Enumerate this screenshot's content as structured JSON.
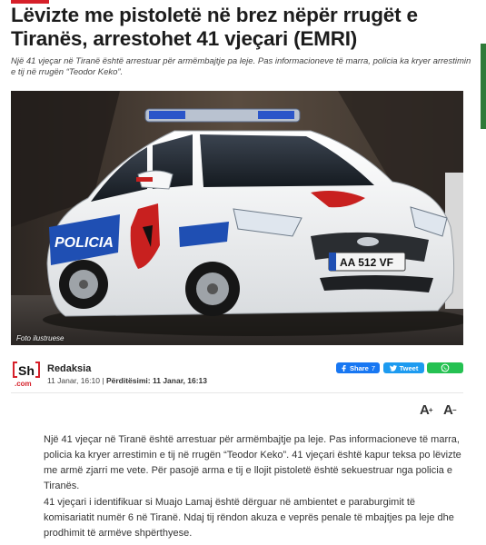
{
  "article": {
    "title": "Lëvizte me pistoletë në brez nëpër rrugët e Tiranës, arrestohet 41 vjeçari (EMRI)",
    "lead": "Një 41 vjeçar në Tiranë është arrestuar për armëmbajtje pa leje. Pas informacioneve të marra, policia ka kryer arrestimin e tij në rrugën “Teodor Keko”.",
    "photo_caption": "Foto ilustruese",
    "photo_texts": {
      "car_side_label": "POLICIA",
      "license_plate": "AA 512 VF"
    },
    "author": {
      "logo_text_top": "Sh",
      "logo_text_bottom": ".com",
      "name": "Redaksia"
    },
    "published": "11 Janar, 16:10",
    "updated_label": "Përditësimi:",
    "updated": "11 Janar, 16:13",
    "share": {
      "facebook_label": "Share",
      "facebook_count": "7",
      "twitter_label": "Tweet",
      "whatsapp_icon": "whatsapp-icon"
    },
    "font_controls": {
      "increase": "A",
      "decrease": "A",
      "increase_mark": "+",
      "decrease_mark": "−"
    },
    "paragraphs": [
      "Një 41 vjeçar në Tiranë është arrestuar për armëmbajtje pa leje. Pas informacioneve të marra, policia ka kryer arrestimin e tij në rrugën “Teodor Keko”. 41 vjeçari është kapur teksa po lëvizte me armë zjarri me vete. Për pasojë arma e tij e llojit pistoletë është sekuestruar nga policia e Tiranës.",
      "41 vjeçari i identifikuar si Muajo Lamaj është dërguar në ambientet e paraburgimit të komisariatit numër 6 në Tiranë. Ndaj tij rëndon akuza e veprës penale të mbajtjes pa leje dhe prodhimit të armëve shpërthyese."
    ]
  },
  "colors": {
    "accent_red": "#d6202a",
    "facebook_blue": "#1877f2",
    "twitter_blue": "#1d9bf0",
    "whatsapp_green": "#25c152",
    "police_blue": "#1f4fb3"
  }
}
